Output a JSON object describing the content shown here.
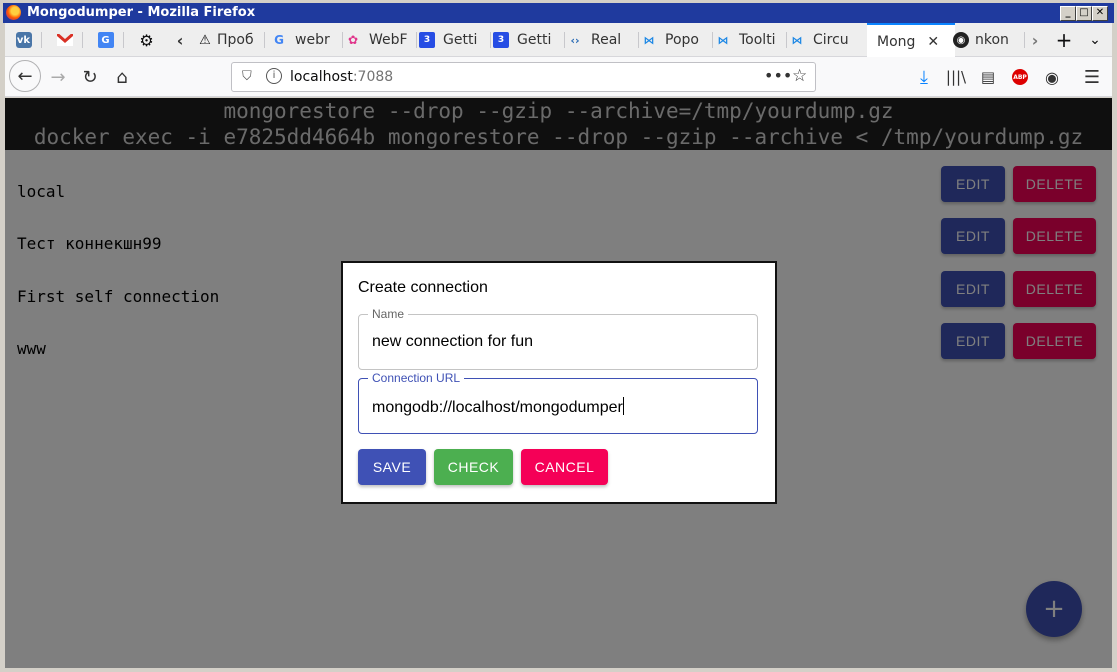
{
  "window": {
    "title": "Mongodumper - Mozilla Firefox",
    "buttons": [
      "minimize",
      "maximize",
      "close"
    ]
  },
  "tabs": [
    {
      "label": "",
      "icon": "vk-icon"
    },
    {
      "label": "",
      "icon": "gmail-icon"
    },
    {
      "label": "",
      "icon": "translate-icon"
    },
    {
      "label": "",
      "icon": "gear-icon"
    },
    {
      "label": "Проб",
      "icon": "warning-icon"
    },
    {
      "label": "webr",
      "icon": "google-icon"
    },
    {
      "label": "WebF",
      "icon": "webflow-icon"
    },
    {
      "label": "Getti",
      "icon": "css3-icon"
    },
    {
      "label": "Getti",
      "icon": "css3-icon"
    },
    {
      "label": "Real",
      "icon": "code-icon"
    },
    {
      "label": "Popo",
      "icon": "mui-icon"
    },
    {
      "label": "Toolti",
      "icon": "mui-icon"
    },
    {
      "label": "Circu",
      "icon": "mui-icon"
    },
    {
      "label": "Mong",
      "icon": "none",
      "active": true
    },
    {
      "label": "nkon",
      "icon": "github-icon"
    }
  ],
  "navbar": {
    "url_host": "localhost",
    "url_port": ":7088"
  },
  "command_panel": {
    "line1": "mongorestore --drop --gzip --archive=/tmp/yourdump.gz",
    "line2": "docker exec -i e7825dd4664b mongorestore --drop --gzip --archive < /tmp/yourdump.gz"
  },
  "connections": [
    {
      "name": "local"
    },
    {
      "name": "Тест коннекшн99"
    },
    {
      "name": "First self connection"
    },
    {
      "name": "www"
    }
  ],
  "row_buttons": {
    "edit": "EDIT",
    "delete": "DELETE"
  },
  "dialog": {
    "title": "Create connection",
    "name_label": "Name",
    "name_value": "new connection for fun",
    "url_label": "Connection URL",
    "url_value": "mongodb://localhost/mongodumper",
    "save": "SAVE",
    "check": "CHECK",
    "cancel": "CANCEL"
  },
  "fab": "+",
  "colors": {
    "primary": "#3f51b5",
    "secondary": "#f50057",
    "check": "#4caf50",
    "titlebar": "#1f3a9e"
  }
}
